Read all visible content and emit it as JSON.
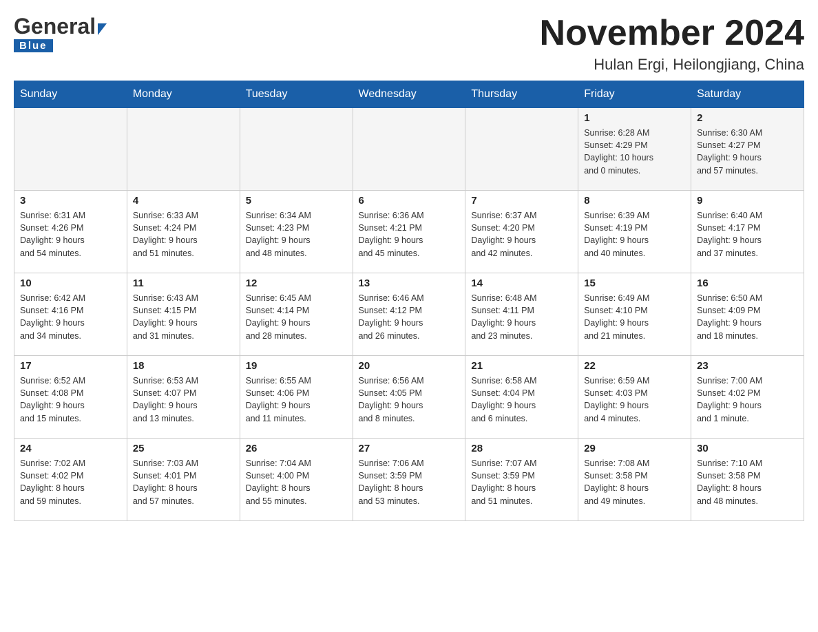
{
  "header": {
    "logo_general": "General",
    "logo_blue": "Blue",
    "main_title": "November 2024",
    "subtitle": "Hulan Ergi, Heilongjiang, China"
  },
  "calendar": {
    "days_of_week": [
      "Sunday",
      "Monday",
      "Tuesday",
      "Wednesday",
      "Thursday",
      "Friday",
      "Saturday"
    ],
    "weeks": [
      [
        {
          "day": "",
          "info": ""
        },
        {
          "day": "",
          "info": ""
        },
        {
          "day": "",
          "info": ""
        },
        {
          "day": "",
          "info": ""
        },
        {
          "day": "",
          "info": ""
        },
        {
          "day": "1",
          "info": "Sunrise: 6:28 AM\nSunset: 4:29 PM\nDaylight: 10 hours\nand 0 minutes."
        },
        {
          "day": "2",
          "info": "Sunrise: 6:30 AM\nSunset: 4:27 PM\nDaylight: 9 hours\nand 57 minutes."
        }
      ],
      [
        {
          "day": "3",
          "info": "Sunrise: 6:31 AM\nSunset: 4:26 PM\nDaylight: 9 hours\nand 54 minutes."
        },
        {
          "day": "4",
          "info": "Sunrise: 6:33 AM\nSunset: 4:24 PM\nDaylight: 9 hours\nand 51 minutes."
        },
        {
          "day": "5",
          "info": "Sunrise: 6:34 AM\nSunset: 4:23 PM\nDaylight: 9 hours\nand 48 minutes."
        },
        {
          "day": "6",
          "info": "Sunrise: 6:36 AM\nSunset: 4:21 PM\nDaylight: 9 hours\nand 45 minutes."
        },
        {
          "day": "7",
          "info": "Sunrise: 6:37 AM\nSunset: 4:20 PM\nDaylight: 9 hours\nand 42 minutes."
        },
        {
          "day": "8",
          "info": "Sunrise: 6:39 AM\nSunset: 4:19 PM\nDaylight: 9 hours\nand 40 minutes."
        },
        {
          "day": "9",
          "info": "Sunrise: 6:40 AM\nSunset: 4:17 PM\nDaylight: 9 hours\nand 37 minutes."
        }
      ],
      [
        {
          "day": "10",
          "info": "Sunrise: 6:42 AM\nSunset: 4:16 PM\nDaylight: 9 hours\nand 34 minutes."
        },
        {
          "day": "11",
          "info": "Sunrise: 6:43 AM\nSunset: 4:15 PM\nDaylight: 9 hours\nand 31 minutes."
        },
        {
          "day": "12",
          "info": "Sunrise: 6:45 AM\nSunset: 4:14 PM\nDaylight: 9 hours\nand 28 minutes."
        },
        {
          "day": "13",
          "info": "Sunrise: 6:46 AM\nSunset: 4:12 PM\nDaylight: 9 hours\nand 26 minutes."
        },
        {
          "day": "14",
          "info": "Sunrise: 6:48 AM\nSunset: 4:11 PM\nDaylight: 9 hours\nand 23 minutes."
        },
        {
          "day": "15",
          "info": "Sunrise: 6:49 AM\nSunset: 4:10 PM\nDaylight: 9 hours\nand 21 minutes."
        },
        {
          "day": "16",
          "info": "Sunrise: 6:50 AM\nSunset: 4:09 PM\nDaylight: 9 hours\nand 18 minutes."
        }
      ],
      [
        {
          "day": "17",
          "info": "Sunrise: 6:52 AM\nSunset: 4:08 PM\nDaylight: 9 hours\nand 15 minutes."
        },
        {
          "day": "18",
          "info": "Sunrise: 6:53 AM\nSunset: 4:07 PM\nDaylight: 9 hours\nand 13 minutes."
        },
        {
          "day": "19",
          "info": "Sunrise: 6:55 AM\nSunset: 4:06 PM\nDaylight: 9 hours\nand 11 minutes."
        },
        {
          "day": "20",
          "info": "Sunrise: 6:56 AM\nSunset: 4:05 PM\nDaylight: 9 hours\nand 8 minutes."
        },
        {
          "day": "21",
          "info": "Sunrise: 6:58 AM\nSunset: 4:04 PM\nDaylight: 9 hours\nand 6 minutes."
        },
        {
          "day": "22",
          "info": "Sunrise: 6:59 AM\nSunset: 4:03 PM\nDaylight: 9 hours\nand 4 minutes."
        },
        {
          "day": "23",
          "info": "Sunrise: 7:00 AM\nSunset: 4:02 PM\nDaylight: 9 hours\nand 1 minute."
        }
      ],
      [
        {
          "day": "24",
          "info": "Sunrise: 7:02 AM\nSunset: 4:02 PM\nDaylight: 8 hours\nand 59 minutes."
        },
        {
          "day": "25",
          "info": "Sunrise: 7:03 AM\nSunset: 4:01 PM\nDaylight: 8 hours\nand 57 minutes."
        },
        {
          "day": "26",
          "info": "Sunrise: 7:04 AM\nSunset: 4:00 PM\nDaylight: 8 hours\nand 55 minutes."
        },
        {
          "day": "27",
          "info": "Sunrise: 7:06 AM\nSunset: 3:59 PM\nDaylight: 8 hours\nand 53 minutes."
        },
        {
          "day": "28",
          "info": "Sunrise: 7:07 AM\nSunset: 3:59 PM\nDaylight: 8 hours\nand 51 minutes."
        },
        {
          "day": "29",
          "info": "Sunrise: 7:08 AM\nSunset: 3:58 PM\nDaylight: 8 hours\nand 49 minutes."
        },
        {
          "day": "30",
          "info": "Sunrise: 7:10 AM\nSunset: 3:58 PM\nDaylight: 8 hours\nand 48 minutes."
        }
      ]
    ]
  }
}
